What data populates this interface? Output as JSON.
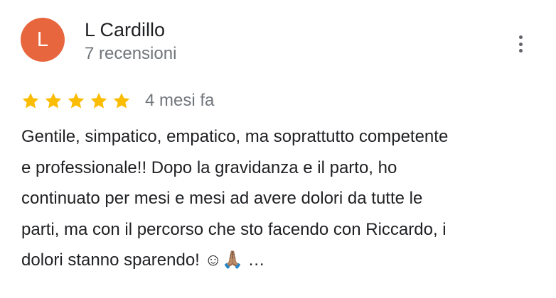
{
  "reviewer": {
    "avatar_letter": "L",
    "avatar_color": "#e8663d",
    "name": "L Cardillo",
    "review_count": "7 recensioni"
  },
  "menu": {
    "icon": "more-vert-icon"
  },
  "rating": {
    "stars": 5,
    "max_stars": 5,
    "star_color": "#fbbc04",
    "time_ago": "4 mesi fa"
  },
  "review": {
    "lines": [
      "Gentile, simpatico, empatico, ma soprattutto competente",
      "e professionale!! Dopo la gravidanza e il parto, ho",
      "continuato per mesi e mesi ad avere dolori da tutte le",
      "parti, ma con il percorso che sto facendo con Riccardo, i",
      "dolori stanno sparendo! ☺🙏🏽 …"
    ]
  }
}
